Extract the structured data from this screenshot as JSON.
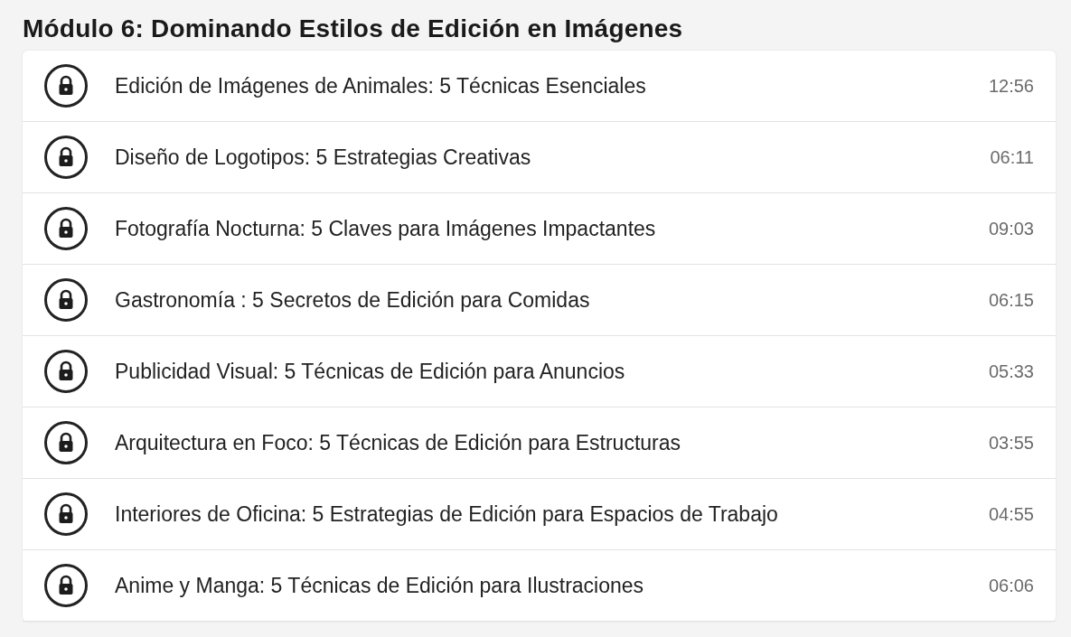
{
  "module": {
    "title": "Módulo 6: Dominando Estilos de Edición en Imágenes"
  },
  "lessons": [
    {
      "title": "Edición de Imágenes de Animales: 5 Técnicas Esenciales",
      "duration": "12:56",
      "locked": true
    },
    {
      "title": "Diseño de Logotipos: 5 Estrategias Creativas",
      "duration": "06:11",
      "locked": true
    },
    {
      "title": "Fotografía Nocturna: 5 Claves para Imágenes Impactantes",
      "duration": "09:03",
      "locked": true
    },
    {
      "title": "Gastronomía : 5 Secretos de Edición para Comidas",
      "duration": "06:15",
      "locked": true
    },
    {
      "title": "Publicidad Visual: 5 Técnicas de Edición para Anuncios",
      "duration": "05:33",
      "locked": true
    },
    {
      "title": "Arquitectura en Foco: 5 Técnicas de Edición para Estructuras",
      "duration": "03:55",
      "locked": true
    },
    {
      "title": "Interiores de Oficina: 5 Estrategias de Edición para Espacios de Trabajo",
      "duration": "04:55",
      "locked": true
    },
    {
      "title": "Anime y Manga: 5 Técnicas de Edición para Ilustraciones",
      "duration": "06:06",
      "locked": true
    }
  ]
}
